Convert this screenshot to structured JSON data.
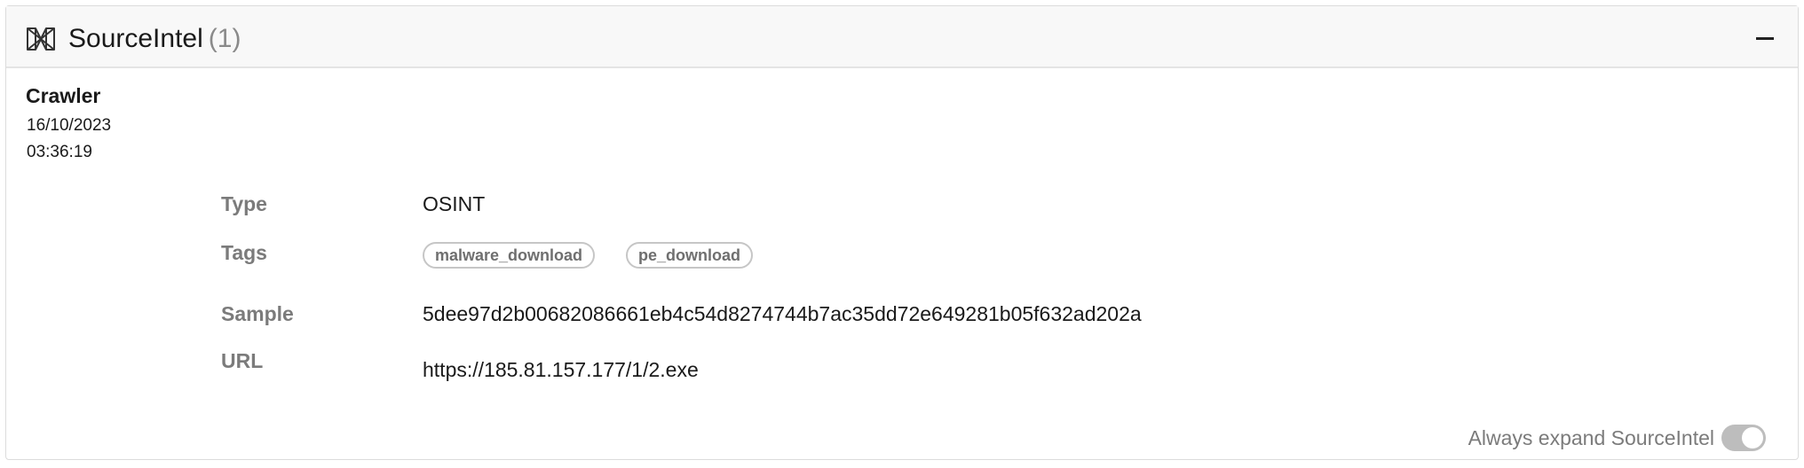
{
  "header": {
    "title": "SourceIntel",
    "count": "(1)",
    "logo_icon": "sourceintel-logo-icon",
    "collapse_icon": "minus-icon"
  },
  "source": {
    "name": "Crawler",
    "date": "16/10/2023",
    "time": "03:36:19"
  },
  "fields": {
    "type_label": "Type",
    "type_value": "OSINT",
    "tags_label": "Tags",
    "tags": [
      "malware_download",
      "pe_download"
    ],
    "sample_label": "Sample",
    "sample_value": "5dee97d2b00682086661eb4c54d8274744b7ac35dd72e649281b05f632ad202a",
    "url_label": "URL",
    "url_value": "https://185.81.157.177/1/2.exe"
  },
  "footer": {
    "expand_label": "Always expand SourceIntel",
    "toggle_state": "on"
  },
  "colors": {
    "label_gray": "#7b7b7b",
    "header_bg": "#f8f8f8",
    "toggle_bg": "#bdbdbd"
  }
}
